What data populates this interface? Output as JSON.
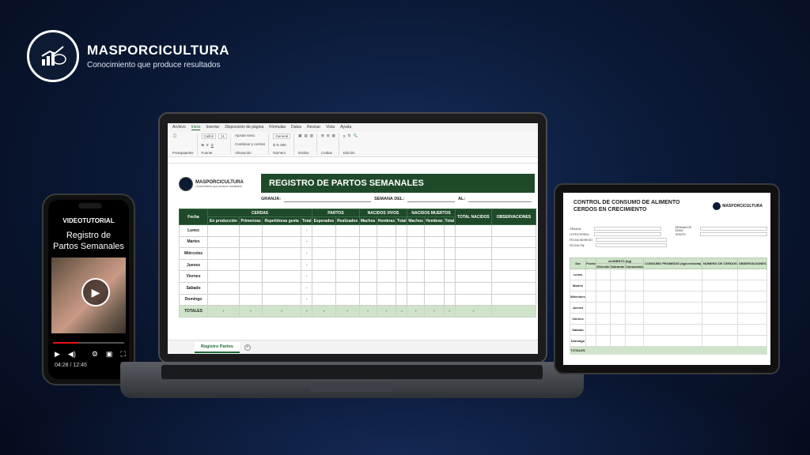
{
  "brand": {
    "name": "MASPORCICULTURA",
    "tagline": "Conocimiento que produce resultados"
  },
  "phone": {
    "label": "VIDEOTUTORIAL",
    "title": "Registro de Partos Semanales",
    "time": "04:28 / 12:45",
    "progress": 0.35
  },
  "excel": {
    "menu": [
      "Archivo",
      "Inicio",
      "Insertar",
      "Disposición de página",
      "Fórmulas",
      "Datos",
      "Revisar",
      "Vista",
      "Ayuda"
    ],
    "ribbon": {
      "font": "Calibri",
      "size": "11",
      "wrap": "Ajustar texto",
      "merge": "Combinar y centrar",
      "format": "General"
    },
    "sheet_brand": "MASPORCICULTURA",
    "sheet_tag": "Conocimiento que produce resultados",
    "title": "REGISTRO DE PARTOS SEMANALES",
    "fields": {
      "granja": "GRANJA:",
      "semana": "SEMANA DEL:",
      "al": "AL:"
    },
    "header_groups": {
      "fecha": "Fecha",
      "cerdas": "CERDAS",
      "partos": "PARTOS",
      "vivos": "NACIDOS VIVOS",
      "muertos": "NACIDOS MUERTOS",
      "total_nacidos": "TOTAL NACIDOS",
      "observaciones": "OBSERVACIONES"
    },
    "subheaders": [
      "En producción",
      "Primerizas",
      "Repetidoras gesta",
      "Total",
      "Esperados",
      "Realizados",
      "Machos",
      "Hembras",
      "Total",
      "Machos",
      "Hembras",
      "Total"
    ],
    "days": [
      "Lunes",
      "Martes",
      "Miércoles",
      "Jueves",
      "Viernes",
      "Sábado",
      "Domingo"
    ],
    "dash": "-",
    "totales": "TOTALES",
    "tab": "Registro Partos"
  },
  "tablet": {
    "title_l1": "CONTROL DE CONSUMO DE ALIMENTO",
    "title_l2": "CERDOS EN CRECIMIENTO",
    "brand": "MASPORCICULTURA",
    "fields": {
      "granja": "GRANJA:",
      "lote": "LOTE/CORRAL:",
      "fecha_ingreso": "FECHA INGRESO:",
      "fecha_fin": "FECHA FIN:",
      "semana_edad": "SEMANA DE EDAD:",
      "grupo": "GRUPO:"
    },
    "headers": {
      "dia": "Día",
      "fecha": "Fecha",
      "alimento": "ALIMENTO (kg)",
      "ofrecido": "Ofrecido",
      "sobrante": "Sobrante",
      "consumido": "Consumido",
      "promedio": "CONSUMO PROMEDIO (kg/cerdo/día)",
      "num_cerdos": "NÚMERO DE CERDOS",
      "obs": "OBSERVACIONES"
    },
    "days": [
      "Lunes",
      "Martes",
      "Miércoles",
      "Jueves",
      "Viernes",
      "Sábado",
      "Domingo"
    ],
    "totales": "TOTALES"
  }
}
